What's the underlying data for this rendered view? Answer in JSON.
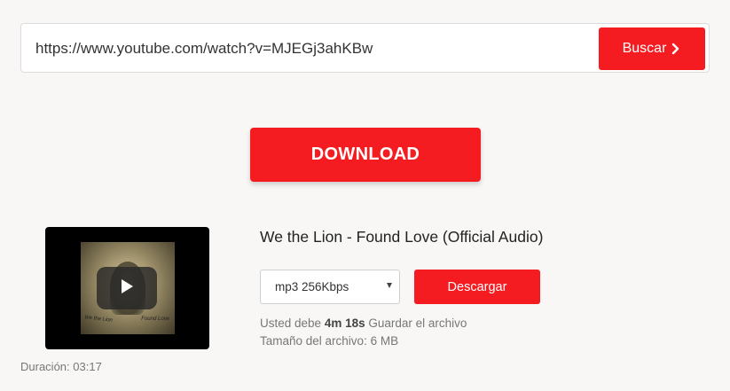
{
  "search": {
    "url_value": "https://www.youtube.com/watch?v=MJEGj3ahKBw",
    "button_label": "Buscar"
  },
  "download_button_label": "DOWNLOAD",
  "video": {
    "title": "We the Lion - Found Love (Official Audio)",
    "duration_label": "Duración:",
    "duration_value": "03:17",
    "thumbnail": {
      "caption_left": "We the Lion",
      "caption_right": "Found Love"
    }
  },
  "format": {
    "selected": "mp3 256Kbps"
  },
  "descargar_label": "Descargar",
  "save_note": {
    "prefix": "Usted debe",
    "time": "4m 18s",
    "suffix": "Guardar el archivo"
  },
  "file_size": {
    "label": "Tamaño del archivo:",
    "value": "6 MB"
  },
  "colors": {
    "accent": "#f41c21",
    "background": "#f8f7f6"
  },
  "icons": {
    "search_button": "chevron-right-icon",
    "thumbnail": "play-icon",
    "select": "caret-down-icon"
  }
}
